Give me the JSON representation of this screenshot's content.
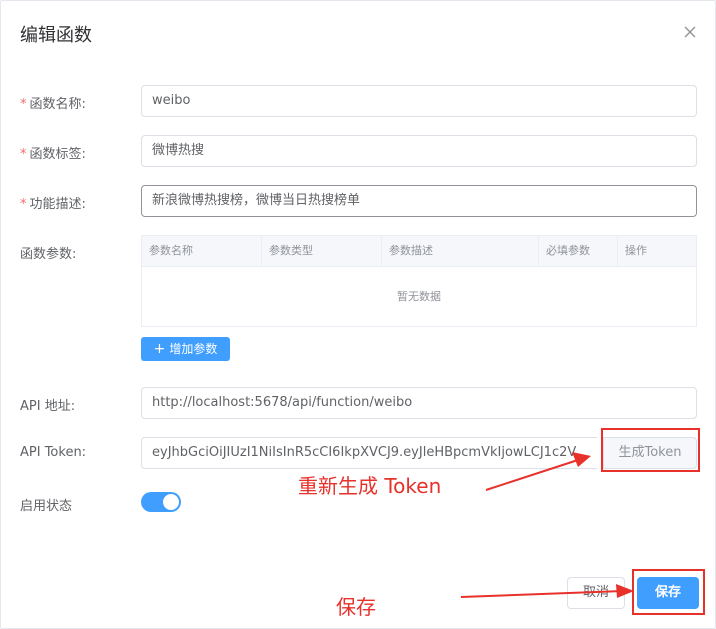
{
  "dialog": {
    "title": "编辑函数",
    "close_icon": "close-icon"
  },
  "form": {
    "name": {
      "label": "函数名称:",
      "required": "*",
      "value": "weibo"
    },
    "tag": {
      "label": "函数标签:",
      "required": "*",
      "value": "微博热搜"
    },
    "desc": {
      "label": "功能描述:",
      "required": "*",
      "value": "新浪微博热搜榜，微博当日热搜榜单"
    },
    "params": {
      "label": "函数参数:",
      "columns": [
        "参数名称",
        "参数类型",
        "参数描述",
        "必填参数",
        "操作"
      ],
      "empty_text": "暂无数据",
      "add_button": "增加参数"
    },
    "api_url": {
      "label": "API 地址:",
      "value": "http://localhost:5678/api/function/weibo"
    },
    "api_token": {
      "label": "API Token:",
      "value": "eyJhbGciOiJIUzI1NiIsInR5cCI6IkpXVCJ9.eyJleHBpcmVkIjowLCJ1c2V",
      "generate_button": "生成Token"
    },
    "status": {
      "label": "启用状态",
      "enabled": true
    }
  },
  "footer": {
    "cancel_label": "取消",
    "save_label": "保存"
  },
  "annotations": {
    "token_note": "重新生成 Token",
    "save_note": "保存",
    "color": "#e8312b"
  },
  "colors": {
    "primary": "#409eff",
    "required": "#f56c6c"
  }
}
